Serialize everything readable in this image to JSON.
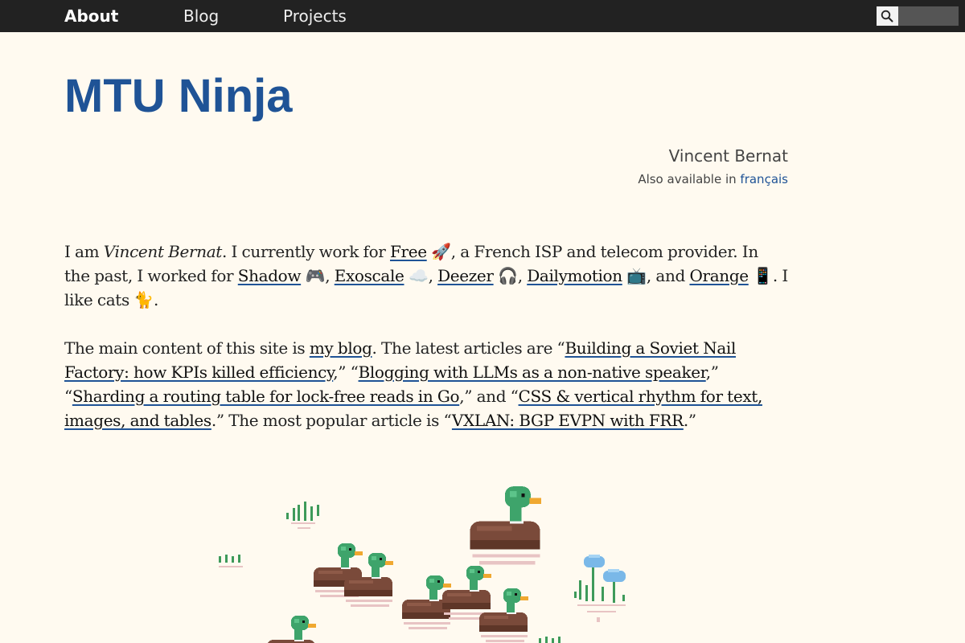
{
  "nav": {
    "about": "About",
    "blog": "Blog",
    "projects": "Projects",
    "search_placeholder": ""
  },
  "header": {
    "site_title": "MTU Ninja",
    "author": "Vincent Bernat",
    "lang_prefix": "Also available in ",
    "lang_link": "français"
  },
  "intro": {
    "t1": "I am ",
    "name": "Vincent Bernat",
    "t2": ". I currently work for ",
    "free": "Free",
    "free_emoji": "🚀",
    "t3": ", a French ISP and telecom provider. In the past, I worked for ",
    "shadow": "Shadow",
    "shadow_emoji": "🎮",
    "sep1": ", ",
    "exoscale": "Exoscale",
    "exoscale_emoji": "☁️",
    "sep2": ", ",
    "deezer": "Deezer",
    "deezer_emoji": "🎧",
    "sep3": ", ",
    "dailymotion": "Dailymotion",
    "dailymotion_emoji": "📺",
    "t4": ", and ",
    "orange": "Orange",
    "orange_emoji": "📱",
    "t5": ". I like cats ",
    "cat_emoji": "🐈",
    "t6": "."
  },
  "blog_para": {
    "t1": "The main content of this site is ",
    "my_blog": "my blog",
    "t2": ". The latest articles are “",
    "a1": "Building a Soviet Nail Factory: how KPIs killed efficiency",
    "t3": ",” “",
    "a2": "Blogging with LLMs as a non-native speaker",
    "t4": ",” “",
    "a3": "Sharding a routing table for lock-free reads in Go",
    "t5": ",” and “",
    "a4": "CSS & vertical rhythm for text, images, and tables",
    "t6": ".” The most popular article is “",
    "popular": "VXLAN: BGP EVPN with FRR",
    "t7": ".”"
  },
  "colors": {
    "nav_bg": "#222222",
    "page_bg": "#fffaf0",
    "title_blue": "#1f5396",
    "duck_head": "#3ea46b",
    "duck_body": "#7a4a3a",
    "duck_bill": "#f0a830",
    "flower": "#7ab8e8",
    "reflection": "#e8c4c4"
  },
  "icons": {
    "search": "search-icon",
    "illustration": "pixel-art-ducks-pond"
  }
}
